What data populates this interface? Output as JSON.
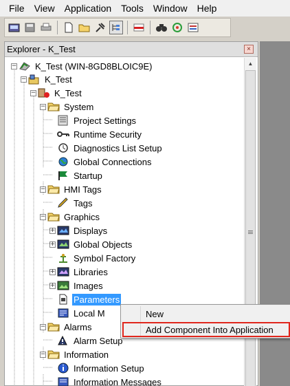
{
  "menubar": {
    "items": [
      "File",
      "View",
      "Application",
      "Tools",
      "Window",
      "Help"
    ]
  },
  "toolbar": {
    "buttons": [
      "open-project-icon",
      "save-icon",
      "print-icon",
      "new-icon",
      "open-folder-icon",
      "pin-icon",
      "explorer-icon",
      "close-red-icon",
      "find-icon",
      "refresh-icon",
      "properties-icon"
    ]
  },
  "explorer": {
    "title": "Explorer -  K_Test",
    "close_glyph": "×"
  },
  "tree": {
    "root": "K_Test (WIN-8GD8BLOIC9E)",
    "server": "K_Test",
    "app": "K_Test",
    "system": "System",
    "project_settings": "Project Settings",
    "runtime_security": "Runtime Security",
    "diagnostics": "Diagnostics List Setup",
    "global_connections": "Global Connections",
    "startup": "Startup",
    "hmi_tags": "HMI Tags",
    "tags": "Tags",
    "graphics": "Graphics",
    "displays": "Displays",
    "global_objects": "Global Objects",
    "symbol_factory": "Symbol Factory",
    "libraries": "Libraries",
    "images": "Images",
    "parameters": "Parameters",
    "local_messages": "Local M",
    "alarms": "Alarms",
    "alarm_setup": "Alarm Setup",
    "information": "Information",
    "information_setup": "Information Setup",
    "information_messages": "Information Messages"
  },
  "context_menu": {
    "new": "New",
    "add_component": "Add Component Into Application"
  },
  "colors": {
    "selection": "#3399ff",
    "highlight_outline": "#e0261c"
  }
}
